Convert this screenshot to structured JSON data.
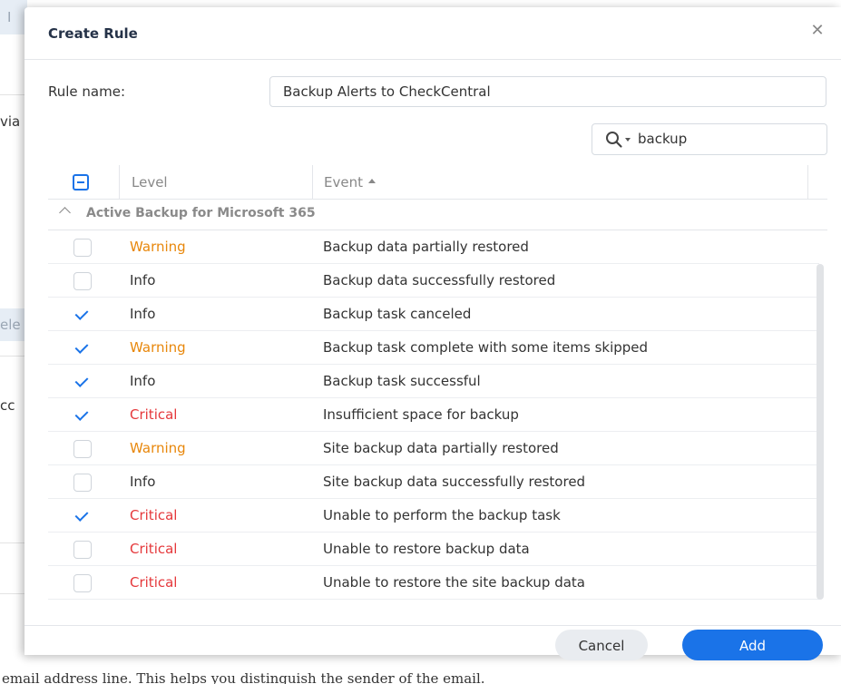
{
  "background": {
    "fragments": [
      "I",
      "via",
      "ele",
      "cc"
    ],
    "bottom_text": "email address line. This helps you distinguish the sender of the email."
  },
  "dialog": {
    "title": "Create Rule",
    "close_icon": "close-icon",
    "rule_name_label": "Rule name:",
    "rule_name_value": "Backup Alerts to CheckCentral",
    "search": {
      "icon": "search-icon",
      "value": "backup"
    },
    "table": {
      "columns": {
        "level": "Level",
        "event": "Event"
      },
      "group": "Active Backup for Microsoft 365",
      "rows": [
        {
          "checked": false,
          "level": "Warning",
          "event": "Backup data partially restored"
        },
        {
          "checked": false,
          "level": "Info",
          "event": "Backup data successfully restored"
        },
        {
          "checked": true,
          "level": "Info",
          "event": "Backup task canceled"
        },
        {
          "checked": true,
          "level": "Warning",
          "event": "Backup task complete with some items skipped"
        },
        {
          "checked": true,
          "level": "Info",
          "event": "Backup task successful"
        },
        {
          "checked": true,
          "level": "Critical",
          "event": "Insufficient space for backup"
        },
        {
          "checked": false,
          "level": "Warning",
          "event": "Site backup data partially restored"
        },
        {
          "checked": false,
          "level": "Info",
          "event": "Site backup data successfully restored"
        },
        {
          "checked": true,
          "level": "Critical",
          "event": "Unable to perform the backup task"
        },
        {
          "checked": false,
          "level": "Critical",
          "event": "Unable to restore backup data"
        },
        {
          "checked": false,
          "level": "Critical",
          "event": "Unable to restore the site backup data"
        }
      ]
    },
    "buttons": {
      "cancel": "Cancel",
      "add": "Add"
    }
  },
  "colors": {
    "accent": "#1a73e8",
    "warning": "#e8870b",
    "info": "#333333",
    "critical": "#e5383b"
  }
}
